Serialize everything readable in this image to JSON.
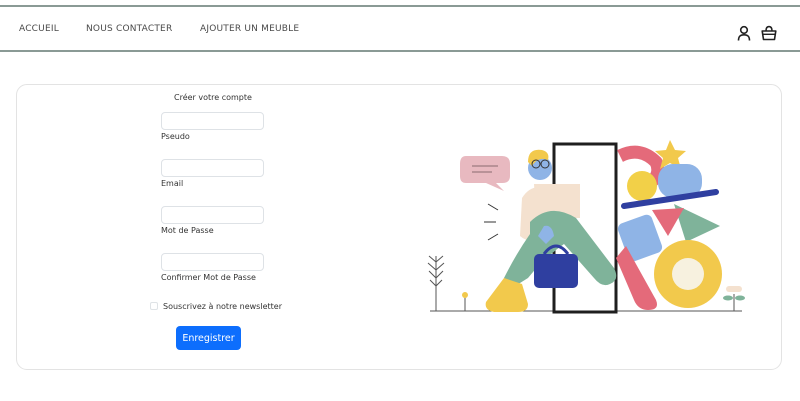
{
  "nav": {
    "links": [
      "ACCUEIL",
      "NOUS CONTACTER",
      "AJOUTER UN MEUBLE"
    ],
    "icons": [
      "user-icon",
      "basket-icon"
    ]
  },
  "form": {
    "title": "Créer votre compte",
    "fields": [
      {
        "label": "Pseudo",
        "value": ""
      },
      {
        "label": "Email",
        "value": ""
      },
      {
        "label": "Mot de Passe",
        "value": ""
      },
      {
        "label": "Confirmer Mot de Passe",
        "value": ""
      }
    ],
    "newsletter_label": "Souscrivez à notre newsletter",
    "newsletter_checked": false,
    "submit_label": "Enregistrer"
  },
  "colors": {
    "primary": "#0d6efd",
    "nav_border": "#8a9a95"
  },
  "illustration": "person-walking-through-door-with-bag"
}
